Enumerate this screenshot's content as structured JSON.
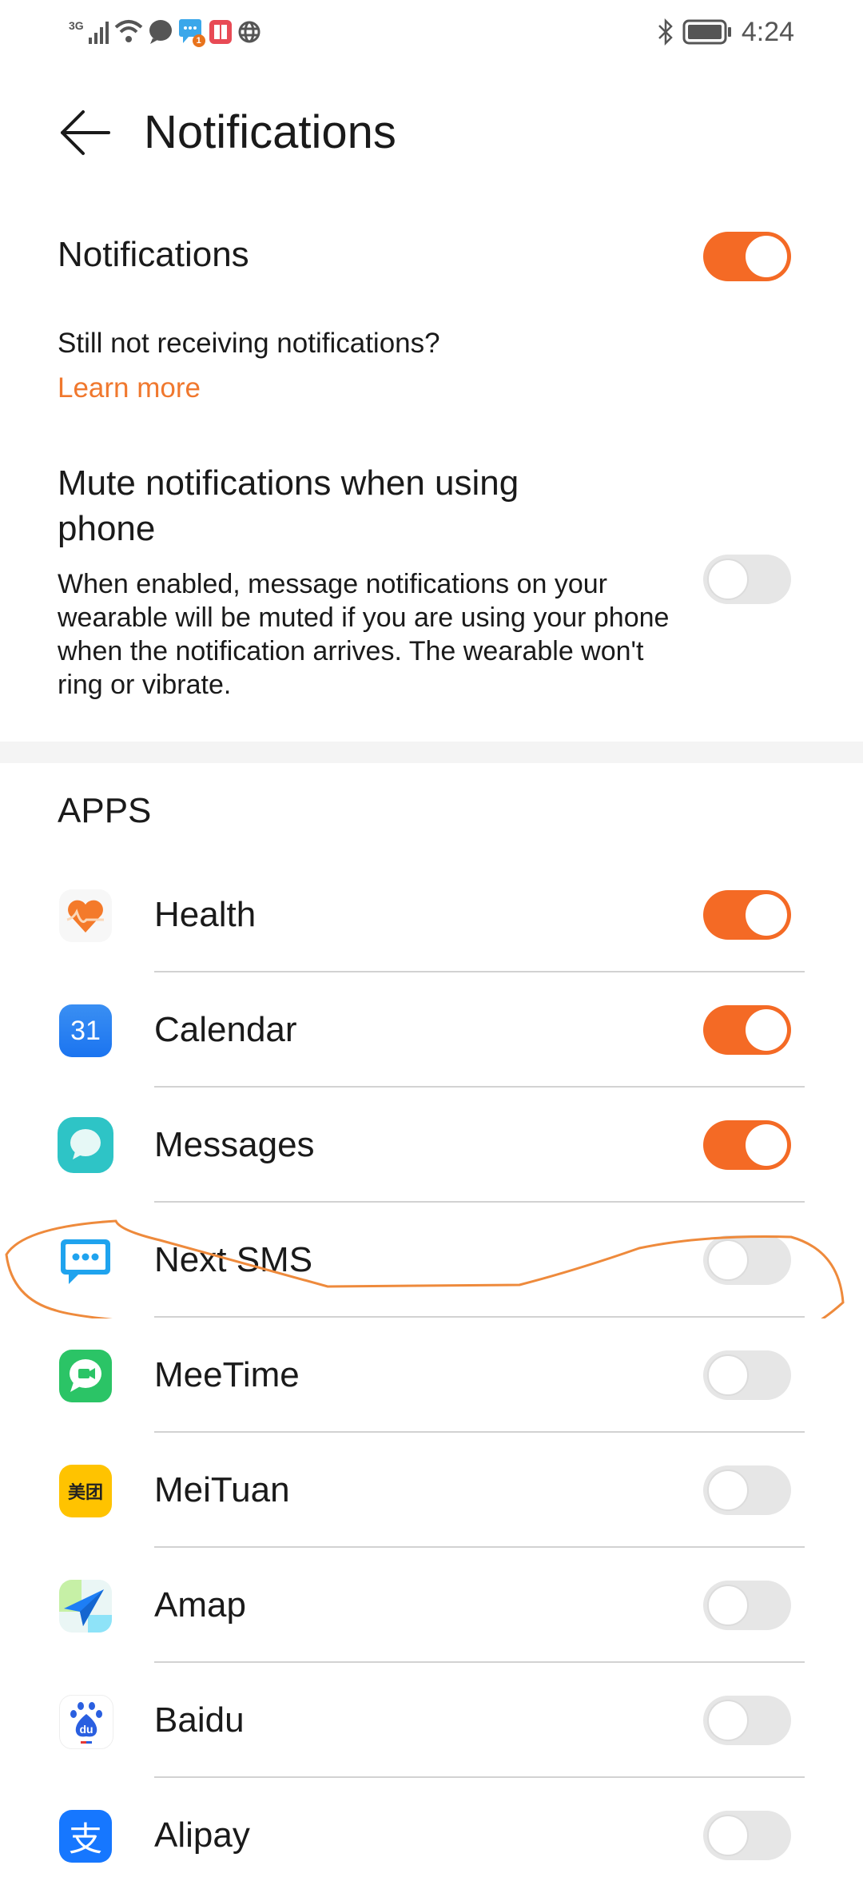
{
  "status_bar": {
    "network": "3G",
    "notification_badge": "1",
    "time": "4:24",
    "icons": [
      "signal-icon",
      "wifi-icon",
      "chat-bubble-icon",
      "sms-notification-icon",
      "book-icon",
      "globe-icon",
      "bluetooth-icon",
      "battery-icon"
    ]
  },
  "header": {
    "back_icon": "arrow-left-icon",
    "title": "Notifications"
  },
  "notifications": {
    "label": "Notifications",
    "enabled": true,
    "help_text": "Still not receiving notifications?",
    "learn_more": "Learn more"
  },
  "mute": {
    "title_line1": "Mute notifications when using",
    "title_line2": "phone",
    "description": "When enabled, message notifications on your wearable will be muted if you are using your phone when the notification arrives. The wearable won't ring or vibrate.",
    "enabled": false
  },
  "apps_section": {
    "heading": "APPS",
    "items": [
      {
        "name": "Health",
        "icon": "health-heart-icon",
        "enabled": true
      },
      {
        "name": "Calendar",
        "icon": "calendar-icon",
        "icon_text": "31",
        "enabled": true
      },
      {
        "name": "Messages",
        "icon": "messages-bubble-icon",
        "enabled": true
      },
      {
        "name": "Next SMS",
        "icon": "next-sms-icon",
        "enabled": false,
        "annotated": true
      },
      {
        "name": "MeeTime",
        "icon": "meetime-icon",
        "enabled": false
      },
      {
        "name": "MeiTuan",
        "icon": "meituan-icon",
        "icon_text": "美团",
        "enabled": false
      },
      {
        "name": "Amap",
        "icon": "amap-icon",
        "enabled": false
      },
      {
        "name": "Baidu",
        "icon": "baidu-icon",
        "icon_text": "du",
        "enabled": false
      },
      {
        "name": "Alipay",
        "icon": "alipay-icon",
        "icon_text": "支",
        "enabled": false
      }
    ]
  },
  "colors": {
    "accent": "#f46a25",
    "link": "#f0782e",
    "toggle_off": "#e6e6e6",
    "annotation": "#ee8a3c"
  }
}
